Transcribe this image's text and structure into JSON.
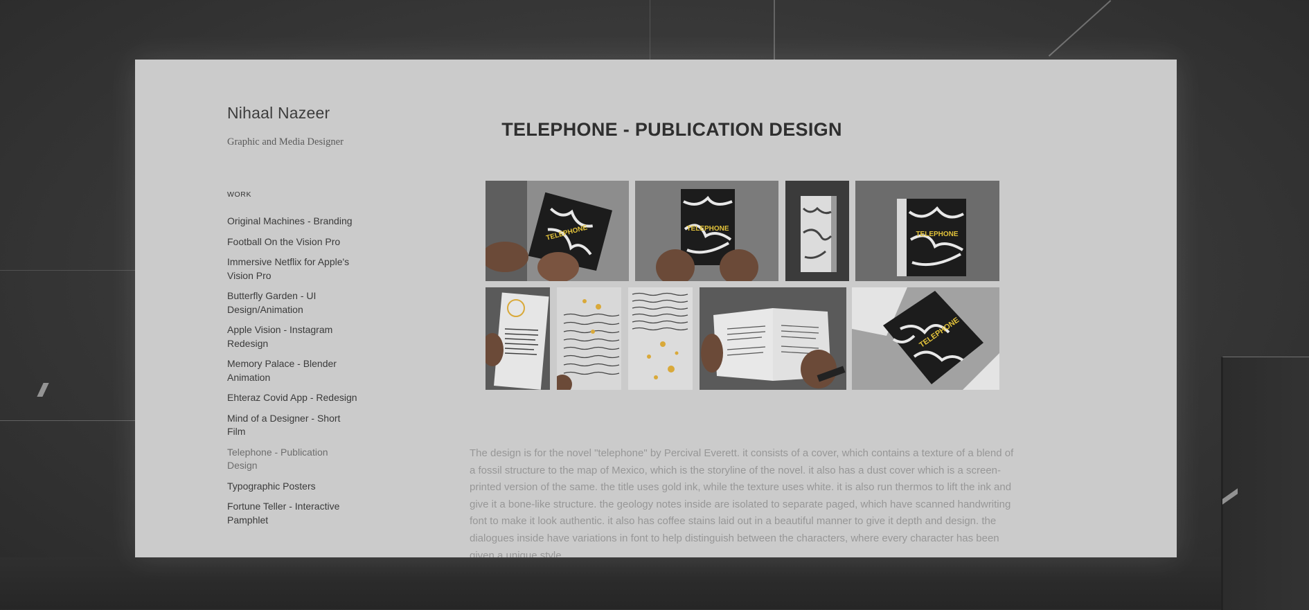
{
  "site": {
    "name": "Nihaal Nazeer",
    "subtitle": "Graphic and Media Designer"
  },
  "sidebar": {
    "section_label": "WORK",
    "items": [
      {
        "label": "Original Machines - Branding"
      },
      {
        "label": "Football On the Vision Pro"
      },
      {
        "label": "Immersive Netflix for Apple's Vision Pro"
      },
      {
        "label": "Butterfly Garden - UI Design/Animation"
      },
      {
        "label": "Apple Vision - Instagram Redesign"
      },
      {
        "label": "Memory Palace - Blender Animation"
      },
      {
        "label": "Ehteraz Covid App - Redesign"
      },
      {
        "label": "Mind of a Designer - Short Film"
      },
      {
        "label": "Telephone - Publication Design",
        "active": true
      },
      {
        "label": "Typographic Posters"
      },
      {
        "label": "Fortune Teller - Interactive Pamphlet"
      }
    ]
  },
  "project": {
    "title": "TELEPHONE - PUBLICATION DESIGN",
    "cover_text": "TELEPHONE",
    "description": "The design is for the novel \"telephone\" by Percival Everett. it consists of a cover, which contains a texture of a blend of a fossil structure to the map of Mexico, which is the storyline of the novel. it also has a dust cover which is a screen-printed version of the same. the title uses gold ink, while the texture uses white. it is also run thermos to lift the ink and give it a bone-like structure. the geology notes inside are isolated to separate paged, which have scanned handwriting font to make it look authentic. it also has coffee stains laid out in a beautiful manner to give it depth and design. the dialogues inside have variations in font to help distinguish between the characters, where every character has been given a unique style."
  },
  "colors": {
    "page_bg": "#cbcbcb",
    "cover_black": "#1c1c1c",
    "cover_title_gold": "#e2c23a",
    "coffee_stain": "#d9a93a"
  }
}
